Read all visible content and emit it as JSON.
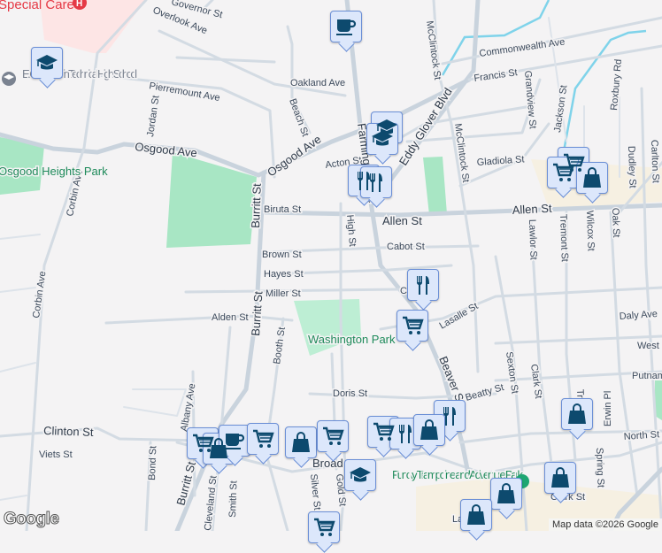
{
  "map": {
    "streets": {
      "governor": "Governor St",
      "overlook": "Overlook Ave",
      "pierremount": "Pierremount Ave",
      "oakland": "Oakland Ave",
      "jordan": "Jordan St",
      "beach": "Beach St",
      "osgood1": "Osgood Ave",
      "osgood2": "Osgood Ave",
      "corbin1": "Corbin Ave",
      "corbin2": "Corbin Ave",
      "burritt1": "Burritt St",
      "burritt2": "Burritt St",
      "burritt3": "Burritt St",
      "biruta": "Biruta St",
      "brown": "Brown St",
      "hayes": "Hayes St",
      "miller": "Miller St",
      "alden": "Alden St",
      "booth": "Booth St",
      "acton": "Acton St",
      "farmington": "Farmington Ave",
      "high": "High St",
      "allen1": "Allen St",
      "allen2": "Allen St",
      "cabot": "Cabot St",
      "cabot2": "Cabot St",
      "eddy": "Eddy Glover Blvd",
      "mcclintock1": "McClintock St",
      "mcclintock2": "McClintock St",
      "commonwealth": "Commonwealth Ave",
      "francis": "Francis St",
      "grandview": "Grandview St",
      "jackson": "Jackson St",
      "roxbury": "Roxbury Rd",
      "gladiola": "Gladiola St",
      "dudley": "Dudley St",
      "carlton": "Carlton St",
      "lawlor": "Lawlor St",
      "tremont": "Tremont St",
      "wilcox": "Wilcox St",
      "oak": "Oak St",
      "lasalle": "Lasalle St",
      "daly": "Daly Ave",
      "west": "West St",
      "putnam": "Putnam",
      "beaver": "Beaver St",
      "beatty": "Beatty St",
      "sexton": "Sexton St",
      "clark": "Clark St",
      "doris": "Doris St",
      "erwin": "Erwin Pl",
      "north": "North St",
      "spring": "Spring St",
      "clinton": "Clinton St",
      "viets": "Viets St",
      "bond": "Bond St",
      "albany": "Albany Ave",
      "cleveland": "Cleveland St",
      "smith": "Smith St",
      "silver": "Silver St",
      "gold": "Gold St",
      "broad": "Broad St",
      "clark2": "Clark St",
      "la": "La... St",
      "tr": "Tr..."
    },
    "places": {
      "hospital": "Special Care",
      "school": "E. C. Goodwin Technical High School",
      "osgood_park": "Osgood Heights Park",
      "washington_park": "Washington Park",
      "funcity": "Funcity Trampoline and Adventure Park"
    },
    "markers": [
      "coffee",
      "school",
      "school",
      "school",
      "restaurant",
      "restaurant",
      "shopping-cart",
      "shopping-cart",
      "shopping-bag",
      "restaurant",
      "shopping-cart",
      "shopping-cart",
      "shopping-bag",
      "coffee",
      "shopping-cart",
      "shopping-bag",
      "shopping-cart",
      "restaurant",
      "shopping-bag",
      "restaurant",
      "shopping-bag",
      "school",
      "shopping-bag",
      "shopping-bag",
      "shopping-bag",
      "shopping-cart"
    ],
    "colors": {
      "marker_fill": "#dce7fb",
      "marker_border": "#6b8fd6",
      "icon": "#0d4a6e",
      "park": "#a8e6c4",
      "road": "#d3dbe3",
      "water": "#7fd3ea"
    },
    "logo": "Google",
    "attribution": "Map data ©2026 Google"
  }
}
